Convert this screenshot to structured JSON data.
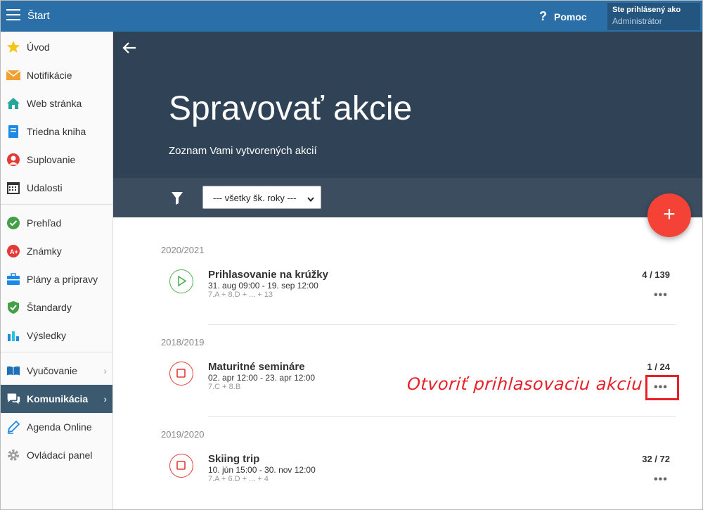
{
  "topbar": {
    "start_label": "Štart",
    "help_label": "Pomoc",
    "user_line1": "Ste prihlásený ako",
    "user_line2": "Administrátor"
  },
  "sidebar": {
    "items": [
      {
        "label": "Úvod",
        "icon": "star-icon"
      },
      {
        "label": "Notifikácie",
        "icon": "envelope-icon"
      },
      {
        "label": "Web stránka",
        "icon": "home-icon"
      },
      {
        "label": "Triedna kniha",
        "icon": "book-icon"
      },
      {
        "label": "Suplovanie",
        "icon": "substitute-icon"
      },
      {
        "label": "Udalosti",
        "icon": "calendar-icon"
      },
      {
        "label": "Prehľad",
        "icon": "check-circle-icon"
      },
      {
        "label": "Známky",
        "icon": "grade-icon"
      },
      {
        "label": "Plány a prípravy",
        "icon": "briefcase-icon"
      },
      {
        "label": "Štandardy",
        "icon": "shield-check-icon"
      },
      {
        "label": "Výsledky",
        "icon": "bar-chart-icon"
      },
      {
        "label": "Vyučovanie",
        "icon": "open-book-icon"
      },
      {
        "label": "Komunikácia",
        "icon": "chat-icon"
      },
      {
        "label": "Agenda Online",
        "icon": "pen-icon"
      },
      {
        "label": "Ovládací panel",
        "icon": "gear-icon"
      }
    ]
  },
  "hero": {
    "title": "Spravovať akcie",
    "subtitle": "Zoznam Vami vytvorených akcií"
  },
  "filter": {
    "selected": "--- všetky šk. roky ---"
  },
  "fab": {
    "label": "+"
  },
  "groups": [
    {
      "year": "2020/2021",
      "event": {
        "title": "Prihlasovanie na krúžky",
        "dates": "31. aug 09:00 - 19. sep 12:00",
        "classes": "7.A + 8.D + ... + 13",
        "count": "4 / 139",
        "status": "play"
      }
    },
    {
      "year": "2018/2019",
      "event": {
        "title": "Maturitné semináre",
        "dates": "02. apr 12:00 - 23. apr 12:00",
        "classes": "7.C + 8.B",
        "count": "1 / 24",
        "status": "stop"
      }
    },
    {
      "year": "2019/2020",
      "event": {
        "title": "Skiing trip",
        "dates": "10. jún 15:00 - 30. nov 12:00",
        "classes": "7.A + 6.D + ... + 4",
        "count": "32 / 72",
        "status": "stop"
      }
    }
  ],
  "more_label": "•••",
  "annotation": "Otvoriť prihlasovaciu akciu",
  "colors": {
    "topbar": "#2a6fa8",
    "hero": "#2f4256",
    "accent_red": "#f44336",
    "play_green": "#4caf50"
  }
}
